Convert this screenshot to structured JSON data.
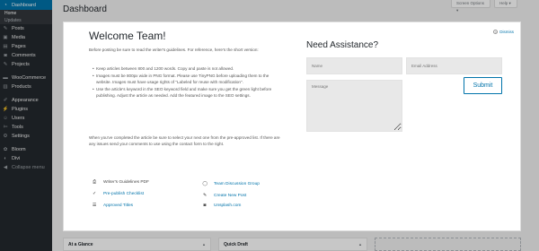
{
  "sidebar": {
    "items": [
      {
        "key": "dashboard",
        "label": "Dashboard",
        "icon": "gauge-icon",
        "glyph": "◔",
        "active": true
      },
      {
        "key": "home",
        "label": "Home",
        "sub": true,
        "current": true
      },
      {
        "key": "updates",
        "label": "Updates",
        "sub": true
      },
      {
        "key": "posts",
        "label": "Posts",
        "icon": "pushpin-icon",
        "glyph": "✎"
      },
      {
        "key": "media",
        "label": "Media",
        "icon": "media-icon",
        "glyph": "▣"
      },
      {
        "key": "pages",
        "label": "Pages",
        "icon": "page-icon",
        "glyph": "▤"
      },
      {
        "key": "comments",
        "label": "Comments",
        "icon": "comment-icon",
        "glyph": "◙"
      },
      {
        "key": "projects",
        "label": "Projects",
        "icon": "portfolio-icon",
        "glyph": "✎"
      },
      {
        "key": "woocommerce",
        "label": "WooCommerce",
        "icon": "woocommerce-icon",
        "glyph": "▬",
        "gap": true
      },
      {
        "key": "products",
        "label": "Products",
        "icon": "archive-icon",
        "glyph": "▥"
      },
      {
        "key": "appearance",
        "label": "Appearance",
        "icon": "brush-icon",
        "glyph": "✐",
        "gap": true
      },
      {
        "key": "plugins",
        "label": "Plugins",
        "icon": "plug-icon",
        "glyph": "⚡"
      },
      {
        "key": "users",
        "label": "Users",
        "icon": "user-icon",
        "glyph": "☺"
      },
      {
        "key": "tools",
        "label": "Tools",
        "icon": "wrench-icon",
        "glyph": "✄"
      },
      {
        "key": "settings",
        "label": "Settings",
        "icon": "settings-icon",
        "glyph": "⚙"
      },
      {
        "key": "bloom",
        "label": "Bloom",
        "icon": "bloom-icon",
        "glyph": "✿",
        "gap": true
      },
      {
        "key": "divi",
        "label": "Divi",
        "icon": "divi-icon",
        "glyph": "◐"
      },
      {
        "key": "collapse",
        "label": "Collapse menu",
        "icon": "collapse-icon",
        "glyph": "◀",
        "collapse": true
      }
    ]
  },
  "header": {
    "title": "Dashboard",
    "screen_options": "Screen Options ▾",
    "help": "Help ▾"
  },
  "welcome": {
    "title": "Welcome Team!",
    "dismiss": "Dismiss",
    "intro": "Before posting be sure to read the writer's guidelines. For reference, here's the short version:",
    "guidelines": [
      "Keep articles between 800 and 1200 words. Copy and paste is not allowed.",
      "Images must be 800px wide in PNG format. Please use TinyPNG before uploading them to the website. Images must have usage rights of \"Labeled for reuse with modification\".",
      "Use the article's keyword in the SEO keyword field and make sure you get the green light before publishing. Adjust the article as needed. Add the featured image to the SEO settings."
    ],
    "closing": "When you've completed the article be sure to select your next one from the pre-approved list. If there are any issues send your comments to use using the contact form to the right.",
    "links": [
      {
        "key": "guidelines_pdf",
        "label": "Writer's Guidelines PDF",
        "icon": "pdf-file-icon",
        "glyph": "⎙",
        "plain": true
      },
      {
        "key": "forum",
        "label": "Team Discussion Group",
        "icon": "chat-bubble-icon",
        "glyph": "◯"
      },
      {
        "key": "checklist",
        "label": "Pre-publish Checklist",
        "icon": "checklist-icon",
        "glyph": "✓"
      },
      {
        "key": "create_post",
        "label": "Create New Post",
        "icon": "edit-icon",
        "glyph": "✎"
      },
      {
        "key": "approved",
        "label": "Approved Titles",
        "icon": "list-icon",
        "glyph": "☰"
      },
      {
        "key": "unsplash",
        "label": "Unsplash.com",
        "icon": "camera-icon",
        "glyph": "◙"
      }
    ]
  },
  "assistance": {
    "title": "Need Assistance?",
    "name_placeholder": "Name",
    "email_placeholder": "Email Address",
    "message_placeholder": "Message",
    "submit_label": "Submit"
  },
  "widgets": {
    "at_a_glance": "At a Glance",
    "quick_draft": "Quick Draft",
    "toggle": "▲"
  },
  "colors": {
    "sidebar_bg": "#23282d",
    "accent": "#0073aa",
    "page_bg": "#f1f1f1"
  }
}
